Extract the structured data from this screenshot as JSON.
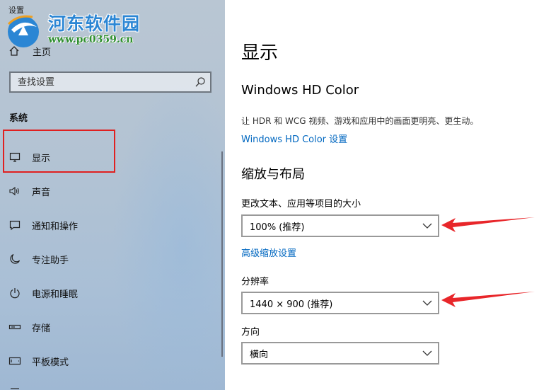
{
  "window": {
    "title": "设置"
  },
  "watermark": {
    "site_name": "河东软件园",
    "url": "www.pc0359.cn"
  },
  "sidebar": {
    "home_label": "主页",
    "search_placeholder": "查找设置",
    "section_label": "系统",
    "items": [
      {
        "label": "显示",
        "icon": "monitor-icon",
        "selected": true
      },
      {
        "label": "声音",
        "icon": "speaker-icon"
      },
      {
        "label": "通知和操作",
        "icon": "message-icon"
      },
      {
        "label": "专注助手",
        "icon": "moon-icon"
      },
      {
        "label": "电源和睡眠",
        "icon": "power-icon"
      },
      {
        "label": "存储",
        "icon": "storage-icon"
      },
      {
        "label": "平板模式",
        "icon": "tablet-icon"
      }
    ]
  },
  "content": {
    "page_title": "显示",
    "hdr": {
      "heading": "Windows HD Color",
      "description": "让 HDR 和 WCG 视频、游戏和应用中的画面更明亮、更生动。",
      "link": "Windows HD Color 设置"
    },
    "scale_layout": {
      "heading": "缩放与布局",
      "scale_label": "更改文本、应用等项目的大小",
      "scale_value": "100% (推荐)",
      "advanced_link": "高级缩放设置",
      "resolution_label": "分辨率",
      "resolution_value": "1440 × 900 (推荐)",
      "orientation_label": "方向",
      "orientation_value": "横向"
    }
  },
  "colors": {
    "accent_link": "#0067c0",
    "highlight_box": "#e02020",
    "annotation_arrow": "#e8262a"
  }
}
